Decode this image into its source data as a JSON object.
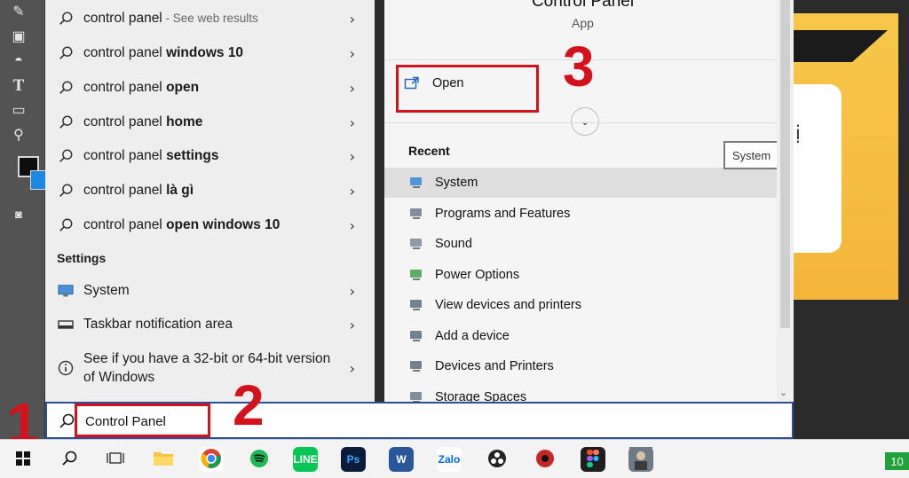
{
  "search_results": {
    "web_items": [
      {
        "prefix": "control panel",
        "bold": "",
        "hint": " - See web results"
      },
      {
        "prefix": "control panel ",
        "bold": "windows 10",
        "hint": ""
      },
      {
        "prefix": "control panel ",
        "bold": "open",
        "hint": ""
      },
      {
        "prefix": "control panel ",
        "bold": "home",
        "hint": ""
      },
      {
        "prefix": "control panel ",
        "bold": "settings",
        "hint": ""
      },
      {
        "prefix": "control panel ",
        "bold": "là gì",
        "hint": ""
      },
      {
        "prefix": "control panel ",
        "bold": "open windows 10",
        "hint": ""
      }
    ],
    "settings_heading": "Settings",
    "settings_items": [
      {
        "label": "System",
        "icon": "monitor-icon"
      },
      {
        "label": "Taskbar notification area",
        "icon": "taskbar-icon"
      },
      {
        "label": "See if you have a 32-bit or 64-bit version of Windows",
        "icon": "info-icon"
      }
    ]
  },
  "detail": {
    "title": "Control Panel",
    "subtitle": "App",
    "open_label": "Open",
    "recent_heading": "Recent",
    "tooltip": "System",
    "recent_items": [
      {
        "label": "System",
        "icon": "system-icon"
      },
      {
        "label": "Programs and Features",
        "icon": "programs-icon"
      },
      {
        "label": "Sound",
        "icon": "sound-icon"
      },
      {
        "label": "Power Options",
        "icon": "power-icon"
      },
      {
        "label": "View devices and printers",
        "icon": "devices-printers-icon"
      },
      {
        "label": "Add a device",
        "icon": "add-device-icon"
      },
      {
        "label": "Devices and Printers",
        "icon": "printer-icon"
      },
      {
        "label": "Storage Spaces",
        "icon": "storage-icon"
      }
    ]
  },
  "search": {
    "value": "Control Panel"
  },
  "annotations": {
    "step1": "1",
    "step2": "2",
    "step3": "3"
  },
  "background_canvas": {
    "card_text": "ị"
  },
  "taskbar": {
    "apps": [
      {
        "name": "start-button",
        "icon": "windows-logo"
      },
      {
        "name": "search-button",
        "icon": "search-icon"
      },
      {
        "name": "task-view-button",
        "icon": "task-view-icon"
      },
      {
        "name": "file-explorer",
        "icon": "folder-icon"
      },
      {
        "name": "chrome",
        "icon": "chrome-icon"
      },
      {
        "name": "spotify",
        "icon": "spotify-icon"
      },
      {
        "name": "line",
        "icon": "line-icon",
        "text": "LINE"
      },
      {
        "name": "photoshop",
        "icon": "photoshop-icon",
        "text": "Ps"
      },
      {
        "name": "word",
        "icon": "word-icon",
        "text": "W"
      },
      {
        "name": "zalo",
        "icon": "zalo-icon",
        "text": "Zalo"
      },
      {
        "name": "obs",
        "icon": "obs-icon"
      },
      {
        "name": "davinci",
        "icon": "davinci-icon"
      },
      {
        "name": "figma",
        "icon": "figma-icon"
      },
      {
        "name": "game",
        "icon": "game-avatar-icon"
      }
    ],
    "battery_text": "10"
  },
  "colors": {
    "accent_red": "#d5121c",
    "search_border": "#2c4e9a",
    "canvas_yellow": "#f3b53a"
  }
}
